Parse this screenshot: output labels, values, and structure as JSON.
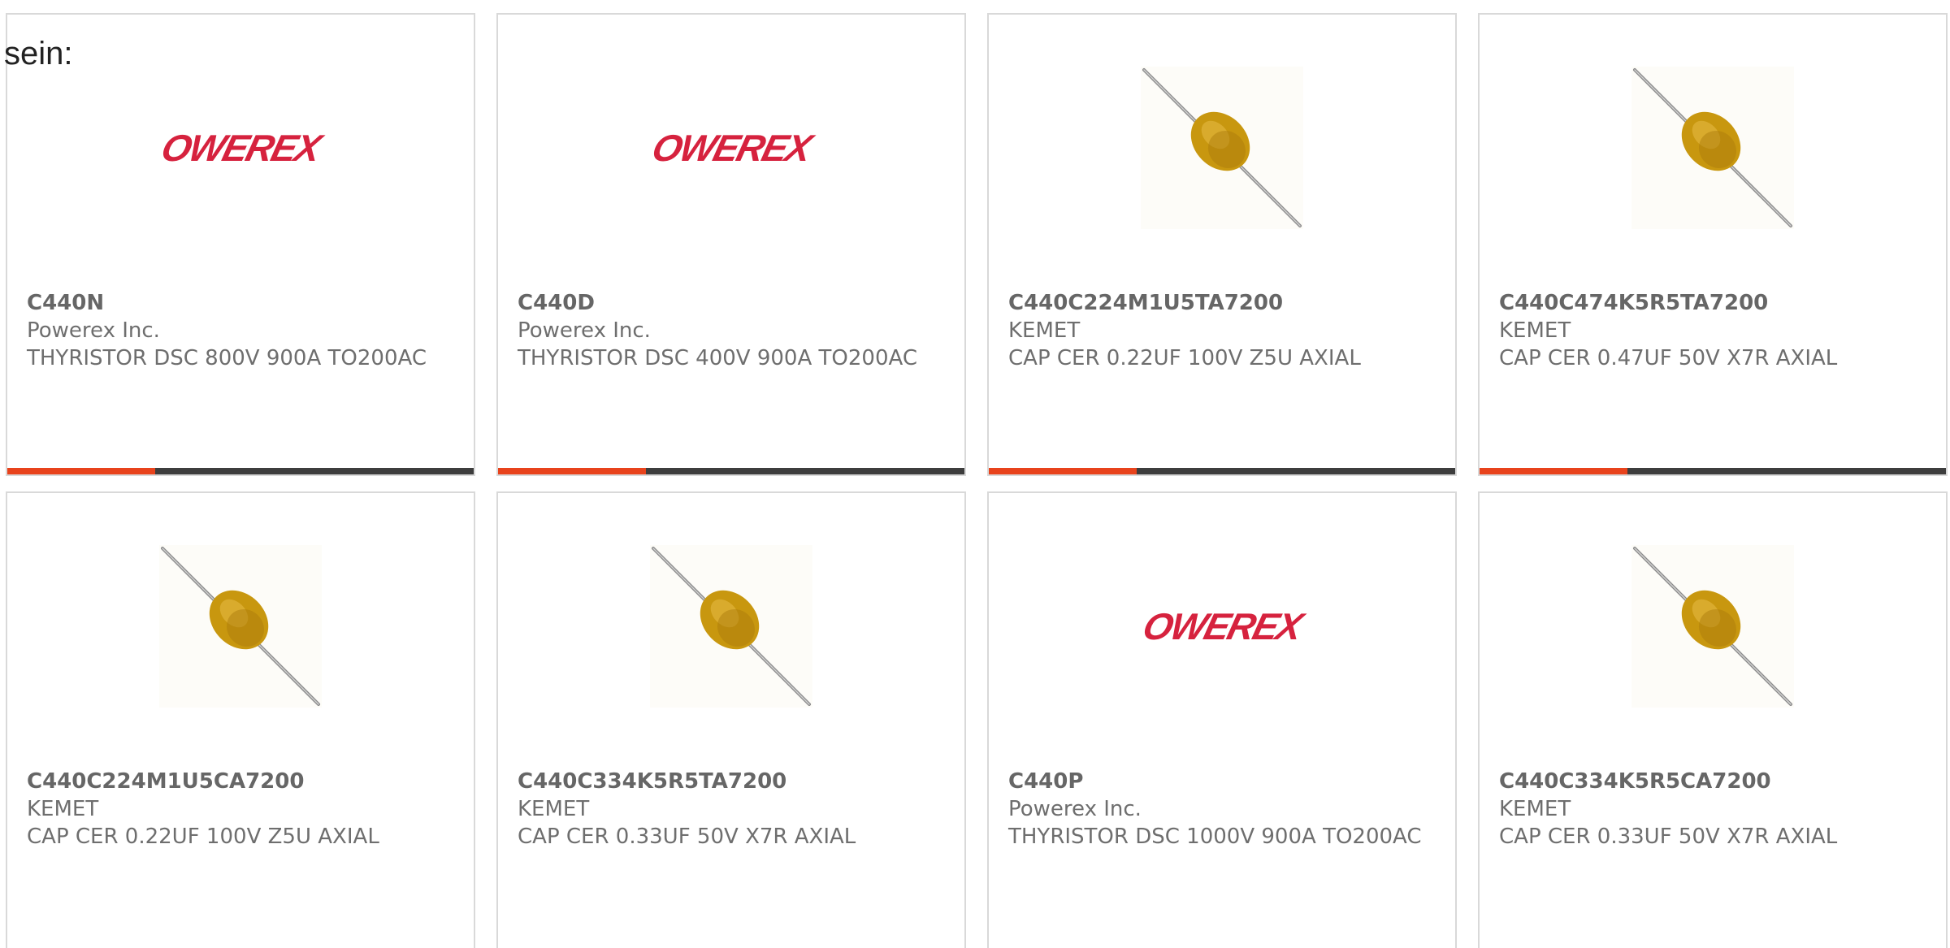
{
  "intro_text": "sein:",
  "colors": {
    "accent_bar": "#e8431c",
    "dark_bar": "#3d3d3d",
    "powerex_brand": "#d6223e",
    "capacitor_body": "#c8970f"
  },
  "products": [
    {
      "part": "C440N",
      "maker": "Powerex Inc.",
      "desc": "THYRISTOR DSC 800V 900A TO200AC",
      "image": "powerex-logo",
      "logo_text": "OWEREX"
    },
    {
      "part": "C440D",
      "maker": "Powerex Inc.",
      "desc": "THYRISTOR DSC 400V 900A TO200AC",
      "image": "powerex-logo",
      "logo_text": "OWEREX"
    },
    {
      "part": "C440C224M1U5TA7200",
      "maker": "KEMET",
      "desc": "CAP CER 0.22UF 100V Z5U AXIAL",
      "image": "axial-capacitor"
    },
    {
      "part": "C440C474K5R5TA7200",
      "maker": "KEMET",
      "desc": "CAP CER 0.47UF 50V X7R AXIAL",
      "image": "axial-capacitor"
    },
    {
      "part": "C440C224M1U5CA7200",
      "maker": "KEMET",
      "desc": "CAP CER 0.22UF 100V Z5U AXIAL",
      "image": "axial-capacitor"
    },
    {
      "part": "C440C334K5R5TA7200",
      "maker": "KEMET",
      "desc": "CAP CER 0.33UF 50V X7R AXIAL",
      "image": "axial-capacitor"
    },
    {
      "part": "C440P",
      "maker": "Powerex Inc.",
      "desc": "THYRISTOR DSC 1000V 900A TO200AC",
      "image": "powerex-logo",
      "logo_text": "OWEREX"
    },
    {
      "part": "C440C334K5R5CA7200",
      "maker": "KEMET",
      "desc": "CAP CER 0.33UF 50V X7R AXIAL",
      "image": "axial-capacitor"
    }
  ]
}
